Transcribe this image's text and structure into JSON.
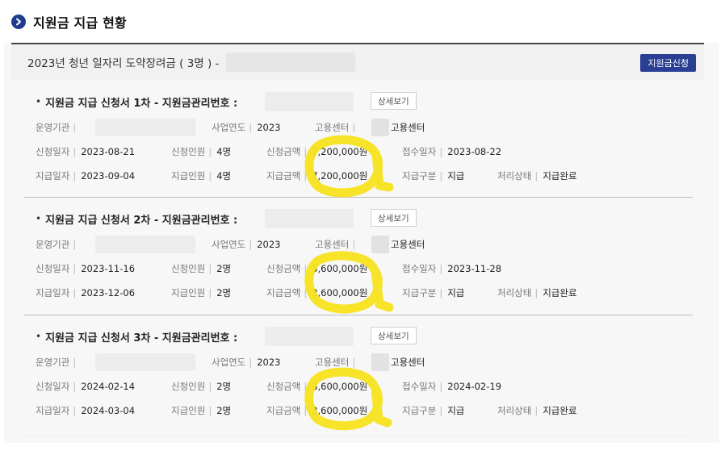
{
  "page": {
    "title": "지원금 지급 현황"
  },
  "program": {
    "title": "2023년 청년 일자리 도약장려금 ( 3명 ) -",
    "apply_label": "지원금신청"
  },
  "labels": {
    "org": "운영기관",
    "year": "사업연도",
    "center": "고용센터",
    "apply_date": "신청일자",
    "apply_people": "신청인원",
    "apply_amount": "신청금액",
    "receipt_date": "접수일자",
    "pay_date": "지급일자",
    "pay_people": "지급인원",
    "pay_amount": "지급금액",
    "pay_type": "지급구분",
    "status": "처리상태",
    "detail_button": "상세보기",
    "separator": "|"
  },
  "applications": [
    {
      "title": "지원금 지급 신청서 1차 - 지원금관리번호 :",
      "year": "2023",
      "center": "고용센터",
      "apply_date": "2023-08-21",
      "apply_people": "4명",
      "apply_amount": "7,200,000원",
      "receipt_date": "2023-08-22",
      "pay_date": "2023-09-04",
      "pay_people": "4명",
      "pay_amount": "7,200,000원",
      "pay_type": "지급",
      "status": "지급완료"
    },
    {
      "title": "지원금 지급 신청서 2차 - 지원금관리번호 :",
      "year": "2023",
      "center": "고용센터",
      "apply_date": "2023-11-16",
      "apply_people": "2명",
      "apply_amount": "3,600,000원",
      "receipt_date": "2023-11-28",
      "pay_date": "2023-12-06",
      "pay_people": "2명",
      "pay_amount": "3,600,000원",
      "pay_type": "지급",
      "status": "지급완료"
    },
    {
      "title": "지원금 지급 신청서 3차 - 지원금관리번호 :",
      "year": "2023",
      "center": "고용센터",
      "apply_date": "2024-02-14",
      "apply_people": "2명",
      "apply_amount": "3,600,000원",
      "receipt_date": "2024-02-19",
      "pay_date": "2024-03-04",
      "pay_people": "2명",
      "pay_amount": "3,600,000원",
      "pay_type": "지급",
      "status": "지급완료"
    }
  ],
  "colors": {
    "accent": "#2a3f94",
    "highlight": "#f7e21c"
  }
}
